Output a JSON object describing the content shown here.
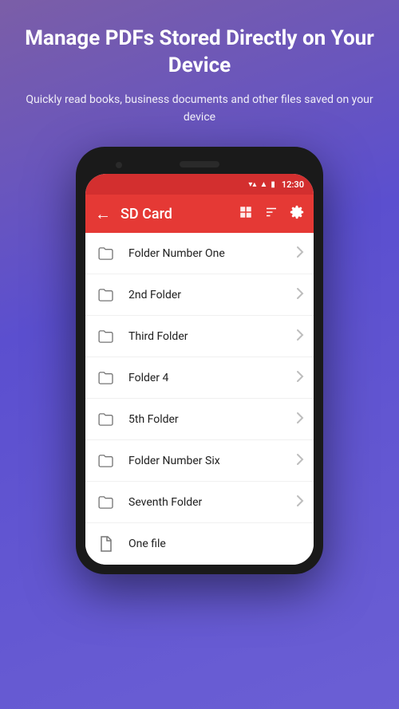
{
  "hero": {
    "title": "Manage PDFs Stored Directly on Your Device",
    "subtitle": "Quickly read books, business documents and other files saved on your device"
  },
  "status_bar": {
    "time": "12:30"
  },
  "app_bar": {
    "title": "SD Card",
    "back_label": "←",
    "icon1": "□",
    "icon2": "⊡",
    "icon3": "⚙"
  },
  "files": [
    {
      "name": "Folder Number One",
      "type": "folder"
    },
    {
      "name": "2nd Folder",
      "type": "folder"
    },
    {
      "name": "Third Folder",
      "type": "folder"
    },
    {
      "name": "Folder 4",
      "type": "folder"
    },
    {
      "name": "5th Folder",
      "type": "folder"
    },
    {
      "name": "Folder Number Six",
      "type": "folder"
    },
    {
      "name": "Seventh Folder",
      "type": "folder"
    },
    {
      "name": "One file",
      "type": "file"
    }
  ]
}
